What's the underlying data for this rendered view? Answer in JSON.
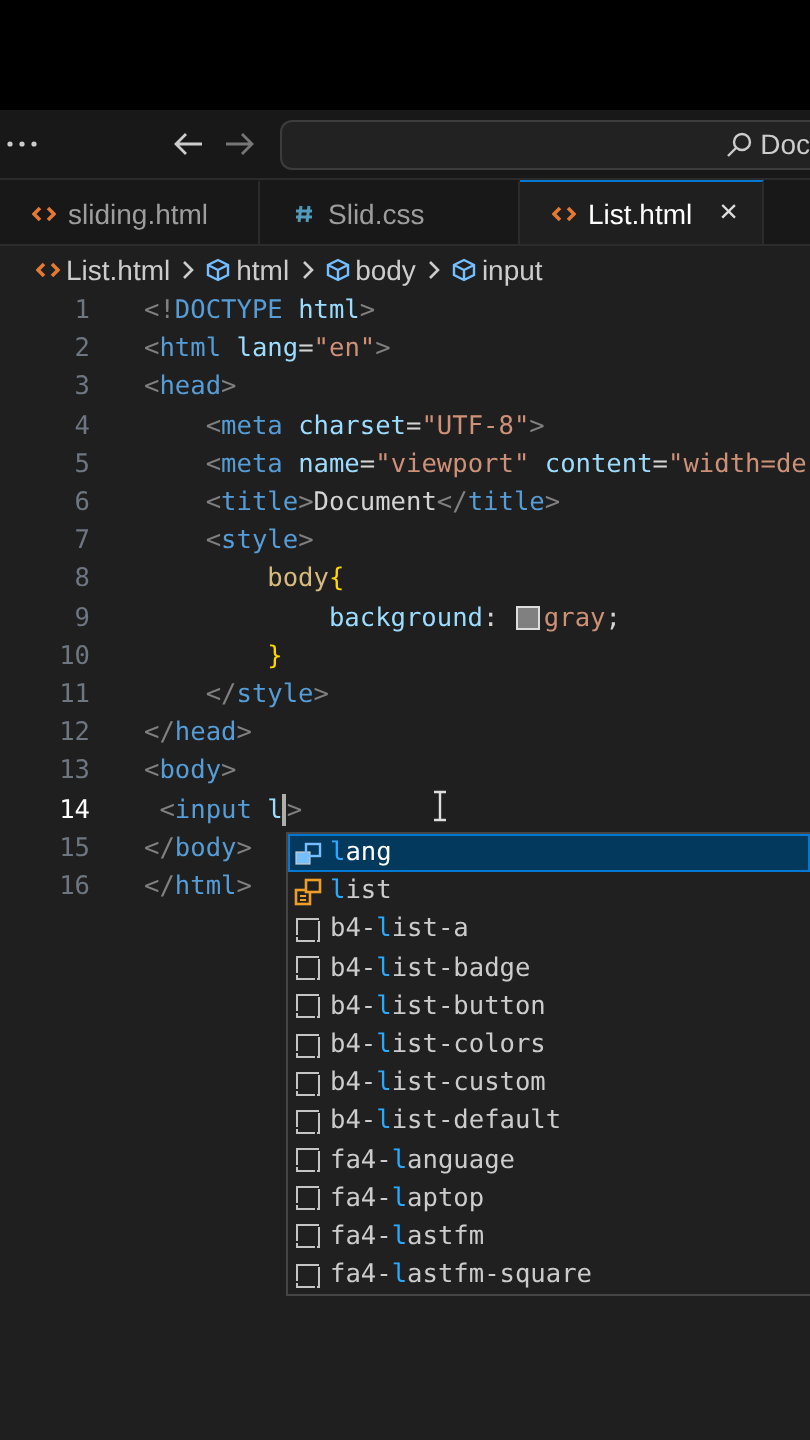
{
  "title_bar": {
    "search_text": "Doc"
  },
  "tabs": [
    {
      "label": "sliding.html",
      "kind": "html",
      "selected": false
    },
    {
      "label": "Slid.css",
      "kind": "css",
      "selected": false
    },
    {
      "label": "List.html",
      "kind": "html",
      "selected": true,
      "close": "×"
    }
  ],
  "breadcrumb": [
    {
      "label": "List.html",
      "kind": "file"
    },
    {
      "label": "html",
      "kind": "element"
    },
    {
      "label": "body",
      "kind": "element"
    },
    {
      "label": "input",
      "kind": "element"
    }
  ],
  "editor": {
    "lines": [
      {
        "number": "1",
        "current": false,
        "tokens": [
          {
            "kind": "punct",
            "t": "<!"
          },
          {
            "kind": "tag",
            "t": "DOCTYPE"
          },
          {
            "kind": "attr",
            "t": " html"
          },
          {
            "kind": "punct",
            "t": ">"
          }
        ]
      },
      {
        "number": "2",
        "current": false,
        "tokens": [
          {
            "kind": "punct",
            "t": "<"
          },
          {
            "kind": "tag",
            "t": "html"
          },
          {
            "kind": "attr",
            "t": " lang"
          },
          {
            "kind": "text",
            "t": "="
          },
          {
            "kind": "str",
            "t": "\"en\""
          },
          {
            "kind": "punct",
            "t": ">"
          }
        ]
      },
      {
        "number": "3",
        "current": false,
        "tokens": [
          {
            "kind": "punct",
            "t": "<"
          },
          {
            "kind": "tag",
            "t": "head"
          },
          {
            "kind": "punct",
            "t": ">"
          }
        ]
      },
      {
        "number": "4",
        "current": false,
        "tokens": [
          {
            "kind": "punct",
            "t": "    <"
          },
          {
            "kind": "tag",
            "t": "meta"
          },
          {
            "kind": "attr",
            "t": " charset"
          },
          {
            "kind": "text",
            "t": "="
          },
          {
            "kind": "str",
            "t": "\"UTF-8\""
          },
          {
            "kind": "punct",
            "t": ">"
          }
        ]
      },
      {
        "number": "5",
        "current": false,
        "tokens": [
          {
            "kind": "punct",
            "t": "    <"
          },
          {
            "kind": "tag",
            "t": "meta"
          },
          {
            "kind": "attr",
            "t": " name"
          },
          {
            "kind": "text",
            "t": "="
          },
          {
            "kind": "str",
            "t": "\"viewport\""
          },
          {
            "kind": "attr",
            "t": " content"
          },
          {
            "kind": "text",
            "t": "="
          },
          {
            "kind": "str",
            "t": "\"width=de"
          }
        ]
      },
      {
        "number": "6",
        "current": false,
        "tokens": [
          {
            "kind": "punct",
            "t": "    <"
          },
          {
            "kind": "tag",
            "t": "title"
          },
          {
            "kind": "punct",
            "t": ">"
          },
          {
            "kind": "text",
            "t": "Document"
          },
          {
            "kind": "punct",
            "t": "</"
          },
          {
            "kind": "tag",
            "t": "title"
          },
          {
            "kind": "punct",
            "t": ">"
          }
        ]
      },
      {
        "number": "7",
        "current": false,
        "tokens": [
          {
            "kind": "punct",
            "t": "    <"
          },
          {
            "kind": "tag",
            "t": "style"
          },
          {
            "kind": "punct",
            "t": ">"
          }
        ]
      },
      {
        "number": "8",
        "current": false,
        "tokens": [
          {
            "kind": "sel",
            "t": "        body"
          },
          {
            "kind": "brace",
            "t": "{"
          }
        ]
      },
      {
        "number": "9",
        "current": false,
        "tokens": [
          {
            "kind": "attr",
            "t": "            background"
          },
          {
            "kind": "text",
            "t": ": "
          },
          {
            "kind": "swatch",
            "color": "#808080"
          },
          {
            "kind": "str",
            "t": "gray"
          },
          {
            "kind": "text",
            "t": ";"
          }
        ]
      },
      {
        "number": "10",
        "current": false,
        "tokens": [
          {
            "kind": "brace",
            "t": "        }"
          }
        ]
      },
      {
        "number": "11",
        "current": false,
        "tokens": [
          {
            "kind": "punct",
            "t": "    </"
          },
          {
            "kind": "tag",
            "t": "style"
          },
          {
            "kind": "punct",
            "t": ">"
          }
        ]
      },
      {
        "number": "12",
        "current": false,
        "tokens": [
          {
            "kind": "punct",
            "t": "</"
          },
          {
            "kind": "tag",
            "t": "head"
          },
          {
            "kind": "punct",
            "t": ">"
          }
        ]
      },
      {
        "number": "13",
        "current": false,
        "tokens": [
          {
            "kind": "punct",
            "t": "<"
          },
          {
            "kind": "tag",
            "t": "body"
          },
          {
            "kind": "punct",
            "t": ">"
          }
        ]
      },
      {
        "number": "14",
        "current": true,
        "tokens": [
          {
            "kind": "punct",
            "t": " <"
          },
          {
            "kind": "tag",
            "t": "input"
          },
          {
            "kind": "attr",
            "t": " l",
            "caret": true
          },
          {
            "kind": "punct",
            "t": ">"
          }
        ]
      },
      {
        "number": "15",
        "current": false,
        "tokens": [
          {
            "kind": "punct",
            "t": "</"
          },
          {
            "kind": "tag",
            "t": "body"
          },
          {
            "kind": "punct",
            "t": ">"
          }
        ]
      },
      {
        "number": "16",
        "current": false,
        "tokens": [
          {
            "kind": "punct",
            "t": "</"
          },
          {
            "kind": "tag",
            "t": "html"
          },
          {
            "kind": "punct",
            "t": ">"
          }
        ]
      }
    ]
  },
  "suggestions": [
    {
      "kind": "field",
      "match": "l",
      "post": "ang",
      "selected": true
    },
    {
      "kind": "enum",
      "match": "l",
      "post": "ist",
      "selected": false
    },
    {
      "kind": "snippet",
      "pre": "b4-",
      "match": "l",
      "post": "ist-a",
      "selected": false
    },
    {
      "kind": "snippet",
      "pre": "b4-",
      "match": "l",
      "post": "ist-badge",
      "selected": false
    },
    {
      "kind": "snippet",
      "pre": "b4-",
      "match": "l",
      "post": "ist-button",
      "selected": false
    },
    {
      "kind": "snippet",
      "pre": "b4-",
      "match": "l",
      "post": "ist-colors",
      "selected": false
    },
    {
      "kind": "snippet",
      "pre": "b4-",
      "match": "l",
      "post": "ist-custom",
      "selected": false
    },
    {
      "kind": "snippet",
      "pre": "b4-",
      "match": "l",
      "post": "ist-default",
      "selected": false
    },
    {
      "kind": "snippet",
      "pre": "fa4-",
      "match": "l",
      "post": "anguage",
      "selected": false
    },
    {
      "kind": "snippet",
      "pre": "fa4-",
      "match": "l",
      "post": "aptop",
      "selected": false
    },
    {
      "kind": "snippet",
      "pre": "fa4-",
      "match": "l",
      "post": "astfm",
      "selected": false
    },
    {
      "kind": "snippet",
      "pre": "fa4-",
      "match": "l",
      "post": "astfm-square",
      "selected": false
    }
  ]
}
